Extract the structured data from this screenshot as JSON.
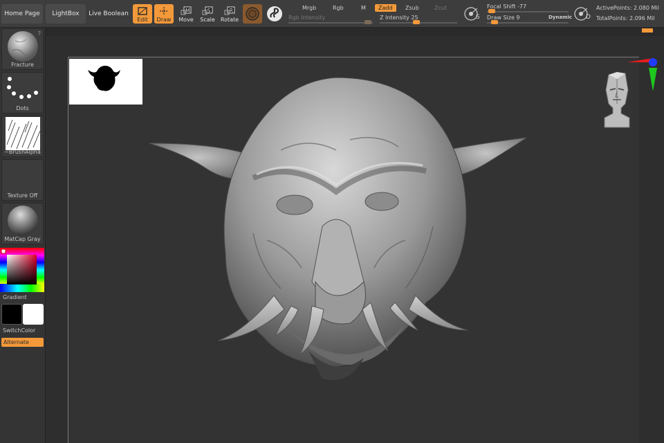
{
  "toolbar": {
    "home_page": "Home Page",
    "lightbox": "LightBox",
    "live_boolean": "Live Boolean",
    "tools": {
      "edit": "Edit",
      "draw": "Draw",
      "move": "Move",
      "scale": "Scale",
      "rotate": "Rotate"
    },
    "modes": {
      "mrgb": "Mrgb",
      "rgb": "Rgb",
      "m": "M",
      "zadd": "Zadd",
      "zsub": "Zsub",
      "zcut": "Zcut",
      "rgb_intensity": "Rgb Intensity",
      "z_intensity": "Z Intensity 25"
    },
    "brush": {
      "focal_shift": "Focal Shift -77",
      "draw_size": "Draw Size 9",
      "dynamic": "Dynamic",
      "s_key": "S",
      "d_key": "D"
    },
    "stats": {
      "active_points": "ActivePoints: 2.080 Mil",
      "total_points": "TotalPoints: 2.096 Mil"
    }
  },
  "shelf": {
    "fracture": "Fracture",
    "dots": "Dots",
    "brush_alpha": "~BrushAlpha",
    "texture_off": "Texture Off",
    "matcap_gray": "MatCap Gray",
    "gradient": "Gradient",
    "switch_color": "SwitchColor",
    "alternate": "Alternate",
    "help": "?"
  },
  "colors": {
    "accent": "#f3993a",
    "primary_swatch": "#000000",
    "secondary_swatch": "#ffffff"
  },
  "icons": [
    "edit-icon",
    "draw-icon",
    "move-icon",
    "scale-icon",
    "rotate-icon",
    "material-sphere-icon",
    "stroke-icon",
    "navigation-cube-icon",
    "axis-gizmo-icon",
    "head-navigator-icon"
  ]
}
